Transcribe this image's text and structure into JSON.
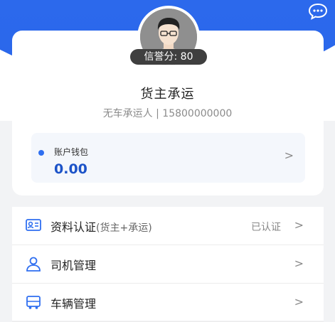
{
  "profile": {
    "credit_label": "信誉分: 80",
    "name": "货主承运",
    "subtitle": "无车承运人 | 15800000000"
  },
  "wallet": {
    "label": "账户钱包",
    "amount": "0.00",
    "arrow": ">"
  },
  "menu": {
    "items": [
      {
        "title": "资料认证",
        "note": "(货主+承运)",
        "status": "已认证",
        "arrow": ">",
        "icon": "id-card-icon"
      },
      {
        "title": "司机管理",
        "note": "",
        "status": "",
        "arrow": ">",
        "icon": "driver-icon"
      },
      {
        "title": "车辆管理",
        "note": "",
        "status": "",
        "arrow": ">",
        "icon": "vehicle-icon"
      }
    ]
  },
  "colors": {
    "brand_blue": "#2f6ff0",
    "amount_blue": "#1c53c8"
  }
}
